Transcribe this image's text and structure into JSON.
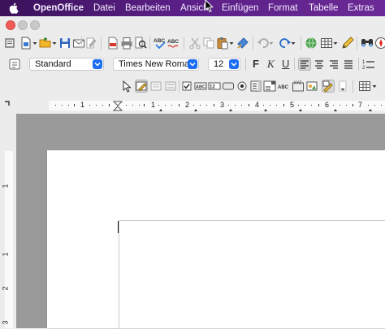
{
  "menubar": {
    "app_name": "OpenOffice",
    "items": [
      "Datei",
      "Bearbeiten",
      "Ansicht",
      "Einfügen",
      "Format",
      "Tabelle",
      "Extras"
    ]
  },
  "formatting": {
    "paragraph_style": "Standard",
    "font_name": "Times New Roman",
    "font_size": "12",
    "bold_label": "F",
    "italic_label": "K",
    "underline_label": "U"
  },
  "ruler": {
    "numbers": [
      "1",
      "1",
      "2",
      "3",
      "4",
      "5",
      "6",
      "7"
    ]
  },
  "vertical_ruler": {
    "numbers": [
      "1",
      "1",
      "2",
      "3"
    ]
  },
  "colors": {
    "menubar": "#4a1a72",
    "accent": "#1c6ef2",
    "doc_background": "#9a9a9a"
  }
}
